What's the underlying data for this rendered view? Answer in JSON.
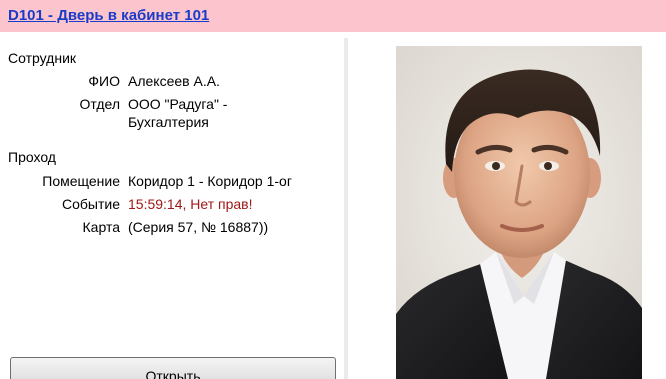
{
  "header": {
    "title": "D101 - Дверь в кабинет 101"
  },
  "employee": {
    "section_title": "Сотрудник",
    "name_label": "ФИО",
    "name_value": "Алексеев А.А.",
    "department_label": "Отдел",
    "department_value": "ООО \"Радуга\" - Бухгалтерия"
  },
  "pass": {
    "section_title": "Проход",
    "room_label": "Помещение",
    "room_value": "Коридор 1 - Коридор 1-ог",
    "event_label": "Событие",
    "event_value": "15:59:14, Нет прав!",
    "card_label": "Карта",
    "card_value": "(Серия 57, № 16887))"
  },
  "actions": {
    "open_label": "Открыть"
  },
  "colors": {
    "title_bar": "#fcc4cc",
    "title_link": "#1a3cc8",
    "event_text": "#a01818"
  },
  "photo": {
    "icon": "employee-photo"
  }
}
